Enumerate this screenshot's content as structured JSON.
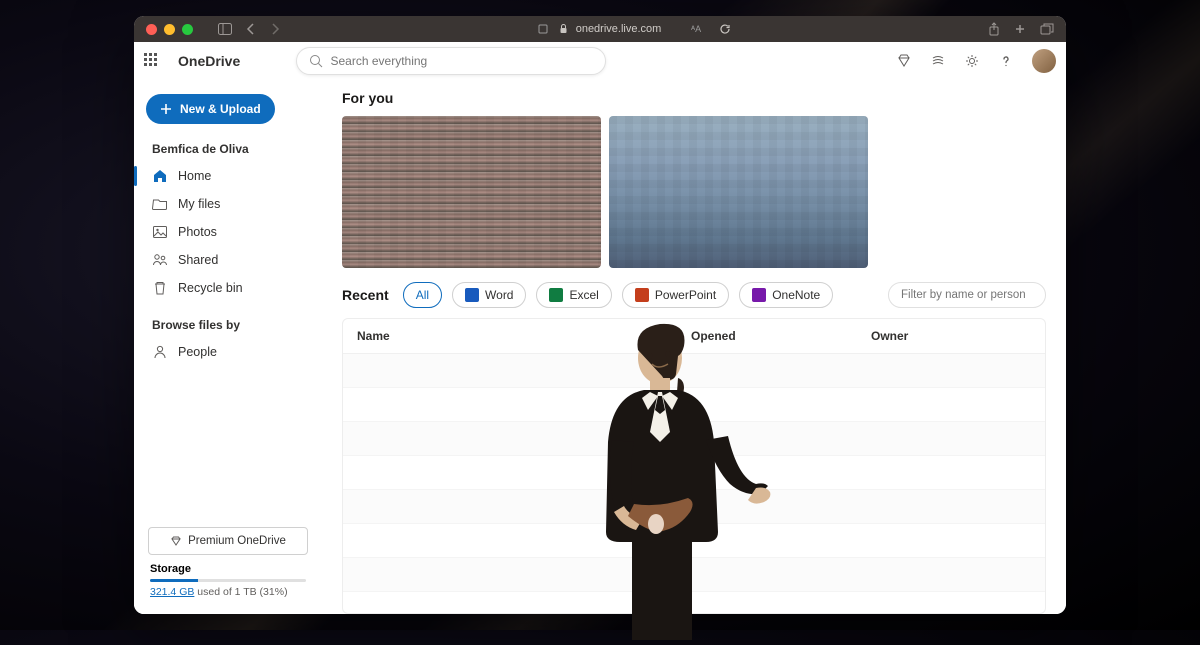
{
  "browser": {
    "url": "onedrive.live.com"
  },
  "brand": "OneDrive",
  "search": {
    "placeholder": "Search everything"
  },
  "newButton": "New & Upload",
  "userName": "Bemfica de Oliva",
  "nav": {
    "home": "Home",
    "myfiles": "My files",
    "photos": "Photos",
    "shared": "Shared",
    "recyclebin": "Recycle bin"
  },
  "browseLabel": "Browse files by",
  "browse": {
    "people": "People"
  },
  "premium": "Premium OneDrive",
  "storage": {
    "label": "Storage",
    "usedLink": "321.4 GB",
    "rest": " used of 1 TB (31%)"
  },
  "foryou": "For you",
  "recent": {
    "label": "Recent",
    "all": "All",
    "word": "Word",
    "excel": "Excel",
    "ppt": "PowerPoint",
    "note": "OneNote",
    "filterPlaceholder": "Filter by name or person"
  },
  "columns": {
    "name": "Name",
    "opened": "Opened",
    "owner": "Owner"
  }
}
